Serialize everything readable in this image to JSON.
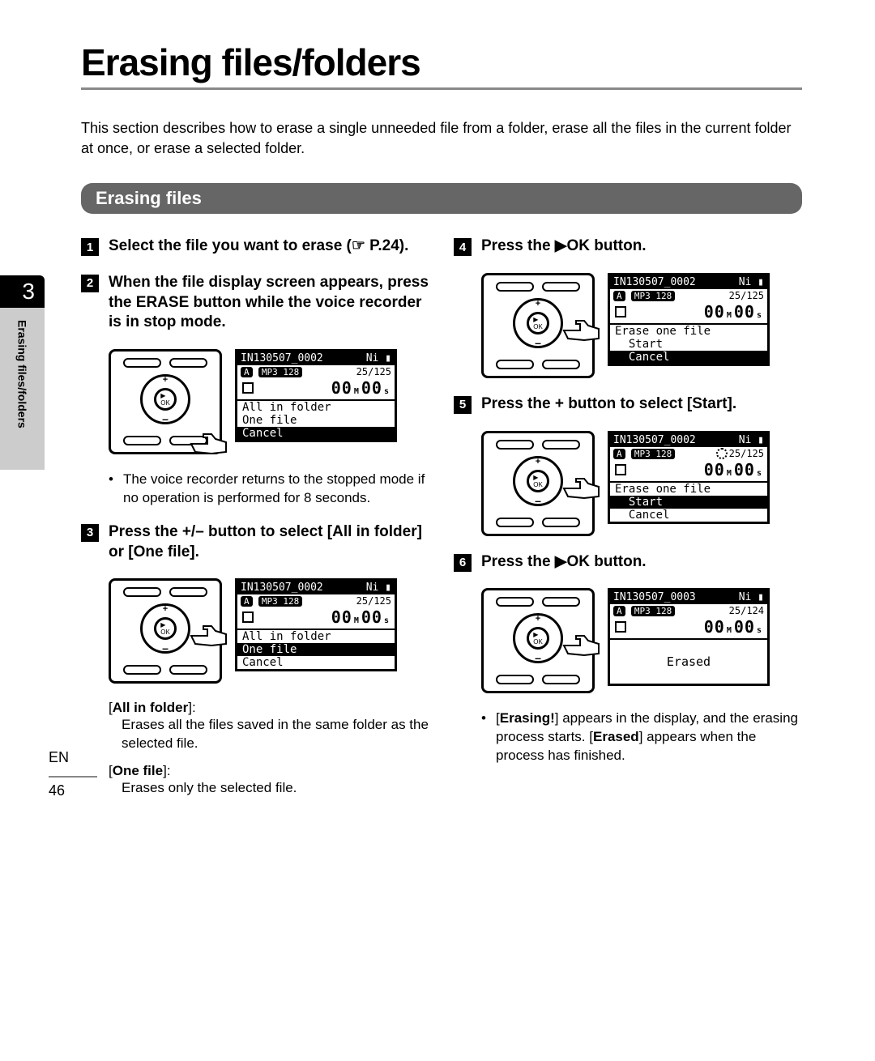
{
  "title": "Erasing files/folders",
  "intro": "This section describes how to erase a single unneeded file from a folder, erase all the files in the current folder at once, or erase a selected folder.",
  "section_heading": "Erasing files",
  "chapter_num": "3",
  "side_label": "Erasing files/folders",
  "lang": "EN",
  "page_num": "46",
  "steps": {
    "s1": "Select the file you want to erase (☞ P.24).",
    "s2": "When the file display screen appears, press the ERASE button while the voice recorder is in stop mode.",
    "s2_note": "The voice recorder returns to the stopped mode if no operation is performed for 8 seconds.",
    "s3_a": "Press the +/– button to select [",
    "s3_b": "All in folder",
    "s3_c": "] or [",
    "s3_d": "One file",
    "s3_e": "].",
    "s4_a": "Press the ",
    "s4_b": "▶OK",
    "s4_c": " button.",
    "s5_a": "Press the + button to select [",
    "s5_b": "Start",
    "s5_c": "].",
    "s6_a": "Press the ",
    "s6_b": "▶OK",
    "s6_c": " button.",
    "s6_note_a": "[",
    "s6_note_b": "Erasing!",
    "s6_note_c": "] appears in the display, and the erasing process starts. [",
    "s6_note_d": "Erased",
    "s6_note_e": "] appears when the process has finished."
  },
  "defs": {
    "all_label": "All in folder",
    "all_desc": "Erases all the files saved in the same folder as the selected file.",
    "one_label": "One file",
    "one_desc": "Erases only the selected file."
  },
  "lcd": {
    "file1": "130507_0002",
    "file2": "130507_0003",
    "ni": "Ni",
    "fmt": "MP3 128",
    "folder": "A",
    "count1": "25/125",
    "count2": "25/124",
    "zeros": "00",
    "m": "M",
    "s": "s",
    "menu_all": "All in folder",
    "menu_one": "One file",
    "menu_cancel": "Cancel",
    "menu_erase_one": "Erase one file",
    "menu_start": "Start",
    "erased": "Erased"
  }
}
